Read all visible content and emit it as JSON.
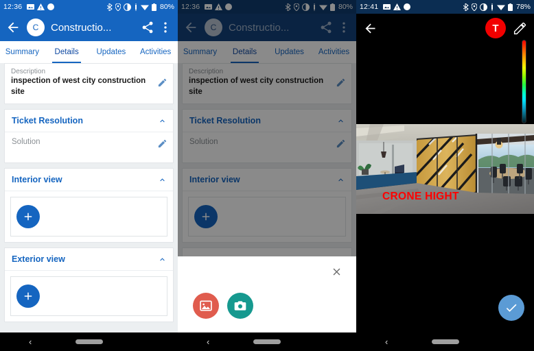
{
  "panel1": {
    "status": {
      "time": "12:36",
      "battery": "80%",
      "left_icons": [
        "screenshot-icon",
        "warning-icon",
        "circle-icon"
      ],
      "right_icons": [
        "bluetooth-icon",
        "location-icon",
        "dnd-icon",
        "vibrate-icon",
        "wifi-icon",
        "battery-icon"
      ]
    },
    "appbar": {
      "back": "back-arrow",
      "avatar_letter": "C",
      "title": "Constructio...",
      "share": "share-icon",
      "overflow": "more-vert-icon"
    },
    "tabs": [
      {
        "label": "Summary",
        "active": false
      },
      {
        "label": "Details",
        "active": true
      },
      {
        "label": "Updates",
        "active": false
      },
      {
        "label": "Activities",
        "active": false
      }
    ],
    "description": {
      "label": "Description",
      "value": "inspection of west city construction site"
    },
    "resolution": {
      "title": "Ticket Resolution",
      "solution_placeholder": "Solution"
    },
    "interior": {
      "title": "Interior view",
      "add": "+"
    },
    "exterior": {
      "title": "Exterior view",
      "add": "+"
    }
  },
  "panel2": {
    "status": {
      "time": "12:36",
      "battery": "80%"
    },
    "appbar": {
      "avatar_letter": "C",
      "title": "Constructio..."
    },
    "tabs": [
      {
        "label": "Summary",
        "active": false
      },
      {
        "label": "Details",
        "active": true
      },
      {
        "label": "Updates",
        "active": false
      },
      {
        "label": "Activities",
        "active": false
      }
    ],
    "description": {
      "label": "Description",
      "value": "inspection of west city construction site"
    },
    "resolution": {
      "title": "Ticket Resolution",
      "solution_placeholder": "Solution"
    },
    "interior": {
      "title": "Interior view",
      "add": "+"
    },
    "sheet": {
      "close": "close-icon",
      "gallery": "gallery-icon",
      "camera": "camera-icon",
      "gallery_color": "#E05C4E",
      "camera_color": "#16998F"
    }
  },
  "panel3": {
    "status": {
      "time": "12:41",
      "battery": "78%"
    },
    "toolbar": {
      "back": "back-arrow",
      "text_tool": "T",
      "pencil": "pencil-icon"
    },
    "annotation": {
      "text": "CRONE HIGHT",
      "color": "#FF0000"
    },
    "done": "check-icon",
    "color_slider": "hue-slider"
  },
  "navbar": {
    "back": "‹",
    "pill": "home-pill"
  },
  "colors": {
    "primary": "#1565C0",
    "accent_red": "#F20000",
    "done_blue": "#5B9BD5"
  }
}
